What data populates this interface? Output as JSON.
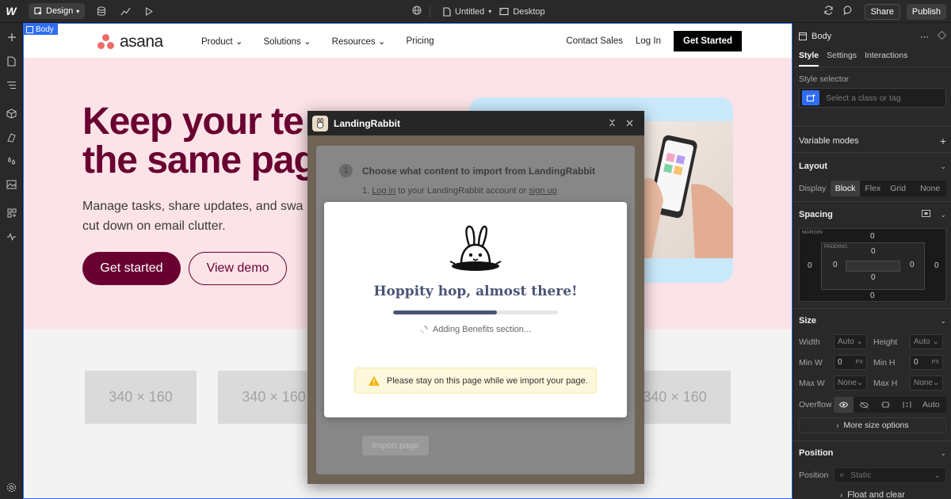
{
  "topbar": {
    "logo": "W",
    "mode_label": "Design",
    "page_name": "Untitled",
    "breakpoint": "Desktop",
    "share_label": "Share",
    "publish_label": "Publish"
  },
  "canvas": {
    "body_tag": "Body",
    "site": {
      "logo_text": "asana",
      "nav": [
        "Product",
        "Solutions",
        "Resources",
        "Pricing"
      ],
      "contact": "Contact Sales",
      "login": "Log In",
      "cta": "Get Started",
      "hero_title": "Keep your te\nthe same pag",
      "hero_sub": "Manage tasks, share updates, and swa\ncut down on email clutter.",
      "btn_primary": "Get started",
      "btn_secondary": "View demo",
      "placeholders": [
        "340 × 160",
        "340 × 160",
        "340 × 160"
      ]
    }
  },
  "plugin": {
    "title": "LandingRabbit",
    "step_number": "1",
    "step_title": "Choose what content to import from LandingRabbit",
    "step_line_1_prefix": "1. ",
    "step_line_1_link_a": "Log in",
    "step_line_1_mid": " to your LandingRabbit account or ",
    "step_line_1_link_b": "sign up",
    "import_button": "Import page",
    "modal": {
      "title": "Hoppity hop, almost there!",
      "progress": 0.63,
      "status": "Adding Benefits section...",
      "warning": "Please stay on this page while we import your page."
    }
  },
  "right_panel": {
    "element": "Body",
    "tabs": [
      "Style",
      "Settings",
      "Interactions"
    ],
    "style_selector_label": "Style selector",
    "selector_placeholder": "Select a class or tag",
    "variable_modes": "Variable modes",
    "layout": "Layout",
    "display_label": "Display",
    "display_options": [
      "Block",
      "Flex",
      "Grid",
      "None"
    ],
    "spacing": "Spacing",
    "margin_label": "MARGIN",
    "padding_label": "PADDING",
    "margin": {
      "top": "0",
      "right": "0",
      "bottom": "0",
      "left": "0"
    },
    "padding": {
      "top": "0",
      "right": "0",
      "bottom": "0",
      "left": "0"
    },
    "size": "Size",
    "width_label": "Width",
    "width_val": "Auto",
    "height_label": "Height",
    "height_val": "Auto",
    "minw_label": "Min W",
    "minw_val": "0",
    "minw_unit": "PX",
    "minh_label": "Min H",
    "minh_val": "0",
    "minh_unit": "PX",
    "maxw_label": "Max W",
    "maxw_val": "None",
    "maxh_label": "Max H",
    "maxh_val": "None",
    "overflow_label": "Overflow",
    "overflow_auto": "Auto",
    "more_size": "More size options",
    "position": "Position",
    "position_label": "Position",
    "position_val": "Static",
    "float_clear": "Float and clear"
  }
}
